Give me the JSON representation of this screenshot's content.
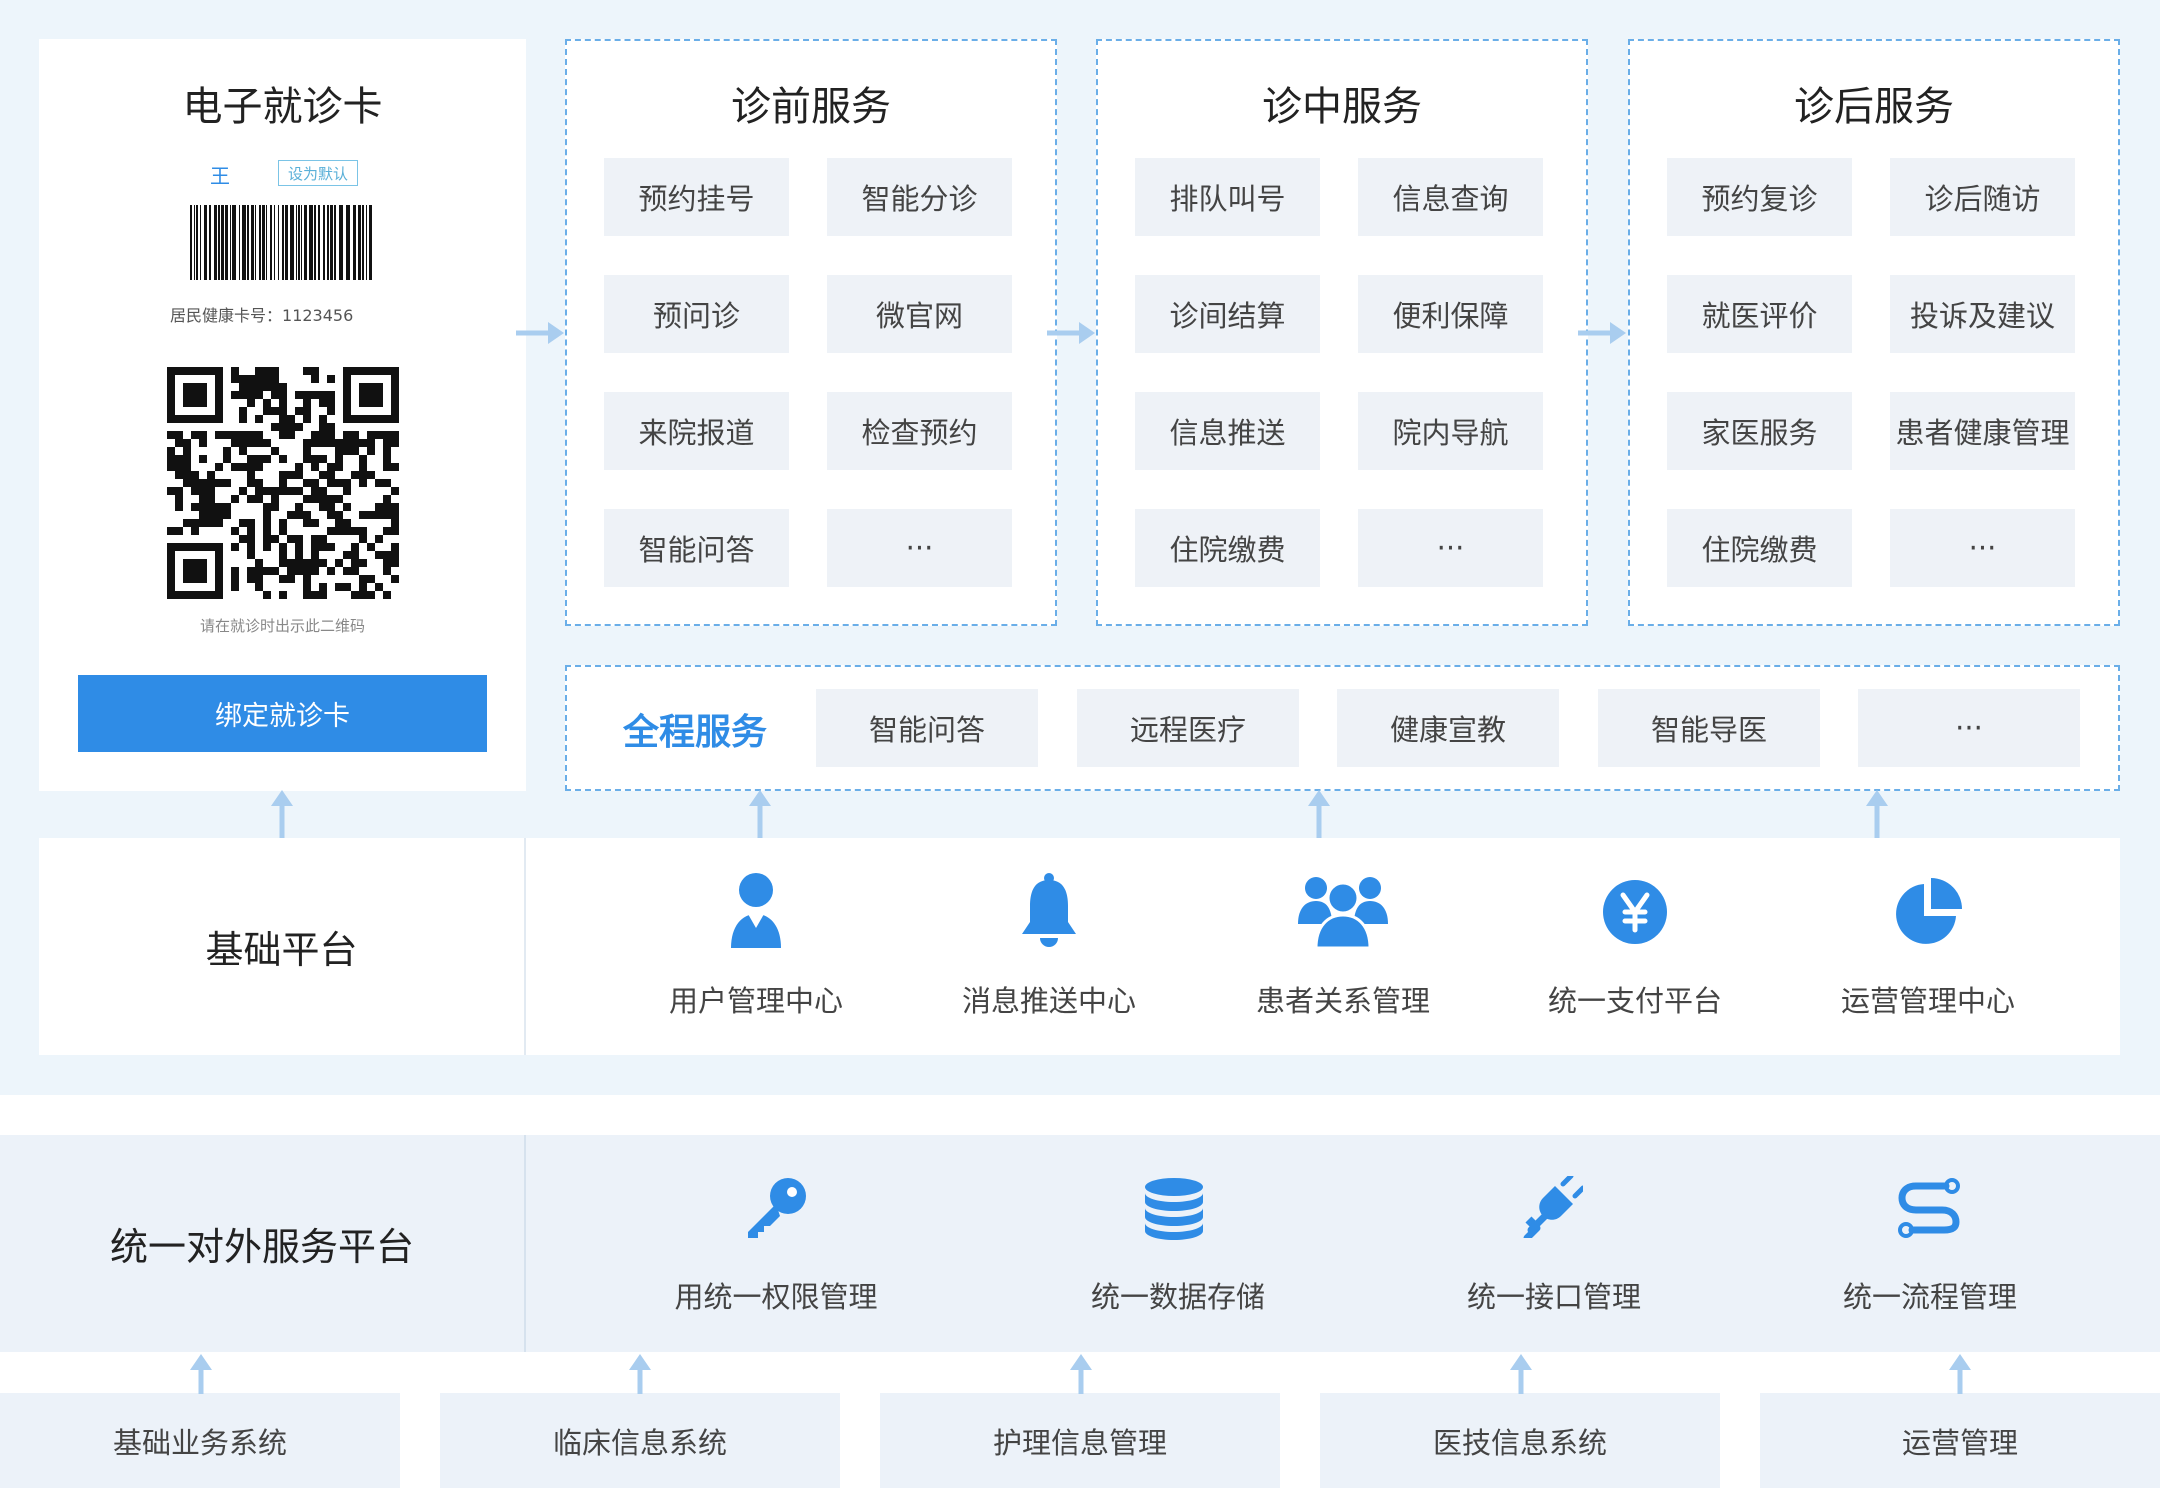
{
  "card": {
    "title": "电子就诊卡",
    "name_tag": "王",
    "badge": "设为默认",
    "card_no_label": "居民健康卡号：",
    "card_no": "1123456",
    "qr_caption": "请在就诊时出示此二维码",
    "bind_button": "绑定就诊卡"
  },
  "phases": [
    {
      "title": "诊前服务",
      "items": [
        "预约挂号",
        "智能分诊",
        "预问诊",
        "微官网",
        "来院报道",
        "检查预约",
        "智能问答",
        "···"
      ]
    },
    {
      "title": "诊中服务",
      "items": [
        "排队叫号",
        "信息查询",
        "诊间结算",
        "便利保障",
        "信息推送",
        "院内导航",
        "住院缴费",
        "···"
      ]
    },
    {
      "title": "诊后服务",
      "items": [
        "预约复诊",
        "诊后随访",
        "就医评价",
        "投诉及建议",
        "家医服务",
        "患者健康管理",
        "住院缴费",
        "···"
      ]
    }
  ],
  "full_service": {
    "title": "全程服务",
    "items": [
      "智能问答",
      "远程医疗",
      "健康宣教",
      "智能导医",
      "···"
    ]
  },
  "base_platform": {
    "title": "基础平台",
    "items": [
      {
        "label": "用户管理中心",
        "icon": "user-icon"
      },
      {
        "label": "消息推送中心",
        "icon": "bell-icon"
      },
      {
        "label": "患者关系管理",
        "icon": "group-icon"
      },
      {
        "label": "统一支付平台",
        "icon": "yen-icon"
      },
      {
        "label": "运营管理中心",
        "icon": "pie-chart-icon"
      }
    ]
  },
  "unified_platform": {
    "title": "统一对外服务平台",
    "items": [
      {
        "label": "用统一权限管理",
        "icon": "key-icon"
      },
      {
        "label": "统一数据存储",
        "icon": "database-icon"
      },
      {
        "label": "统一接口管理",
        "icon": "plug-icon"
      },
      {
        "label": "统一流程管理",
        "icon": "flow-icon"
      }
    ]
  },
  "systems": [
    "基础业务系统",
    "临床信息系统",
    "护理信息管理",
    "医技信息系统",
    "运营管理"
  ],
  "colors": {
    "accent": "#2f8ce6",
    "arrow": "#a9cdef",
    "cell_bg": "#eef2f7",
    "panel_bg": "#edf5fb"
  }
}
